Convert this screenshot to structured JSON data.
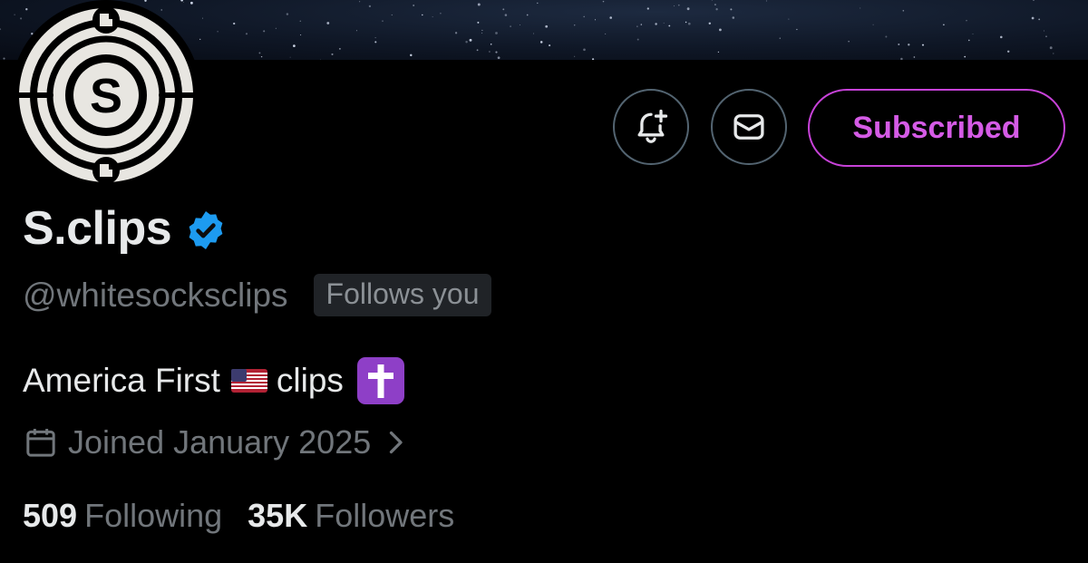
{
  "profile": {
    "display_name": "S.clips",
    "handle": "@whitesocksclips",
    "follows_you": "Follows you",
    "bio_prefix": "America First",
    "bio_suffix": "clips",
    "joined": "Joined January 2025",
    "following_count": "509",
    "following_label": "Following",
    "followers_count": "35K",
    "followers_label": "Followers"
  },
  "actions": {
    "subscribed_label": "Subscribed"
  },
  "avatar": {
    "logo_letter": "S"
  },
  "colors": {
    "accent_subscribed": "#d55be6",
    "verified_blue": "#1d9bf0",
    "muted_text": "#71767b",
    "cross_badge_purple": "#8e3fc7"
  },
  "icons": {
    "notify": "bell-plus-icon",
    "message": "envelope-icon",
    "verified": "verified-badge-icon",
    "calendar": "calendar-icon",
    "chevron": "chevron-right-icon",
    "flag": "us-flag-icon",
    "cross": "latin-cross-icon"
  }
}
